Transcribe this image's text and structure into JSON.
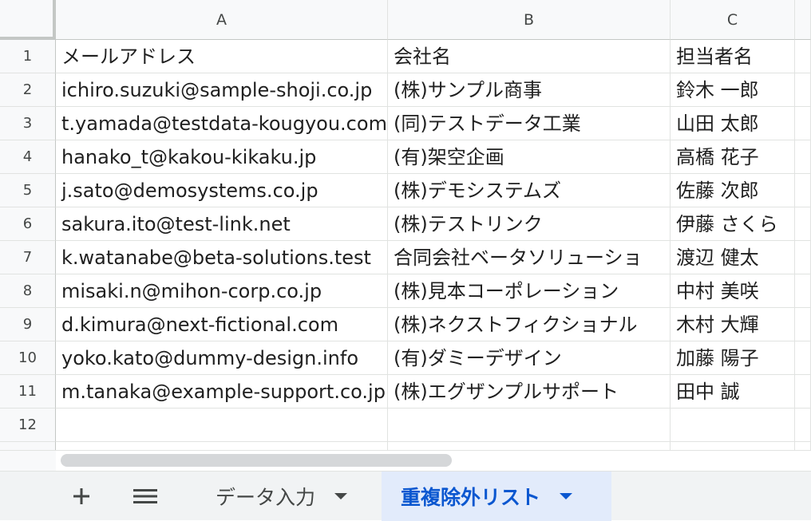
{
  "columns": [
    "A",
    "B",
    "C"
  ],
  "rows": [
    {
      "num": "1",
      "cells": [
        "メールアドレス",
        "会社名",
        "担当者名"
      ]
    },
    {
      "num": "2",
      "cells": [
        "ichiro.suzuki@sample-shoji.co.jp",
        "(株)サンプル商事",
        "鈴木 一郎"
      ]
    },
    {
      "num": "3",
      "cells": [
        "t.yamada@testdata-kougyou.com",
        "(同)テストデータ工業",
        "山田 太郎"
      ]
    },
    {
      "num": "4",
      "cells": [
        "hanako_t@kakou-kikaku.jp",
        "(有)架空企画",
        "高橋 花子"
      ]
    },
    {
      "num": "5",
      "cells": [
        "j.sato@demosystems.co.jp",
        "(株)デモシステムズ",
        "佐藤 次郎"
      ]
    },
    {
      "num": "6",
      "cells": [
        "sakura.ito@test-link.net",
        "(株)テストリンク",
        "伊藤 さくら"
      ]
    },
    {
      "num": "7",
      "cells": [
        "k.watanabe@beta-solutions.test",
        "合同会社ベータソリューショ",
        "渡辺 健太"
      ]
    },
    {
      "num": "8",
      "cells": [
        "misaki.n@mihon-corp.co.jp",
        "(株)見本コーポレーション",
        "中村 美咲"
      ]
    },
    {
      "num": "9",
      "cells": [
        "d.kimura@next-fictional.com",
        "(株)ネクストフィクショナル",
        "木村 大輝"
      ]
    },
    {
      "num": "10",
      "cells": [
        "yoko.kato@dummy-design.info",
        "(有)ダミーデザイン",
        "加藤 陽子"
      ]
    },
    {
      "num": "11",
      "cells": [
        "m.tanaka@example-support.co.jp",
        "(株)エグザンプルサポート",
        "田中 誠"
      ]
    },
    {
      "num": "12",
      "cells": [
        "",
        "",
        ""
      ]
    }
  ],
  "tabbar": {
    "add_icon": "plus-icon",
    "menu_icon": "menu-icon",
    "tabs": [
      {
        "label": "データ入力",
        "active": false
      },
      {
        "label": "重複除外リスト",
        "active": true
      }
    ]
  },
  "colors": {
    "accent": "#0b57d0",
    "active_tab_bg": "#e2ebfb"
  }
}
